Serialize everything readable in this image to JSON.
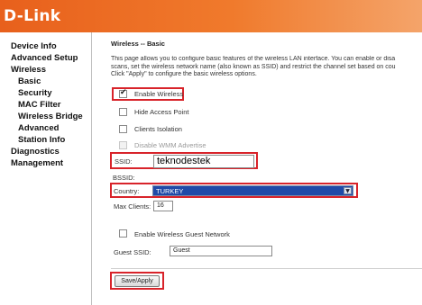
{
  "brand": {
    "logo": "D-Link"
  },
  "sidebar": {
    "items": [
      {
        "label": "Device Info"
      },
      {
        "label": "Advanced Setup"
      },
      {
        "label": "Wireless"
      },
      {
        "label": "Basic"
      },
      {
        "label": "Security"
      },
      {
        "label": "MAC Filter"
      },
      {
        "label": "Wireless Bridge"
      },
      {
        "label": "Advanced"
      },
      {
        "label": "Station Info"
      },
      {
        "label": "Diagnostics"
      },
      {
        "label": "Management"
      }
    ]
  },
  "main": {
    "title": "Wireless -- Basic",
    "description": [
      "This page allows you to configure basic features of the wireless LAN interface. You can enable or disa",
      "scans, set the wireless network name (also known as SSID) and restrict the channel set based on cou",
      "Click \"Apply\" to configure the basic wireless options."
    ],
    "options": {
      "enable_wireless": "Enable Wireless",
      "hide_access_point": "Hide Access Point",
      "clients_isolation": "Clients Isolation",
      "disable_wmm": "Disable WMM Advertise"
    },
    "ssid": {
      "label": "SSID:",
      "value": "teknodestek"
    },
    "bssid": {
      "label": "BSSID:"
    },
    "country": {
      "label": "Country:",
      "value": "TURKEY"
    },
    "max_clients": {
      "label": "Max Clients:",
      "value": "16"
    },
    "guest": {
      "enable_label": "Enable Wireless Guest Network",
      "ssid_label": "Guest SSID:",
      "ssid_value": "Guest"
    },
    "apply_button": "Save/Apply"
  },
  "colors": {
    "header": "#e8601c",
    "highlight": "#d8232a",
    "select": "#1f4aa8"
  }
}
